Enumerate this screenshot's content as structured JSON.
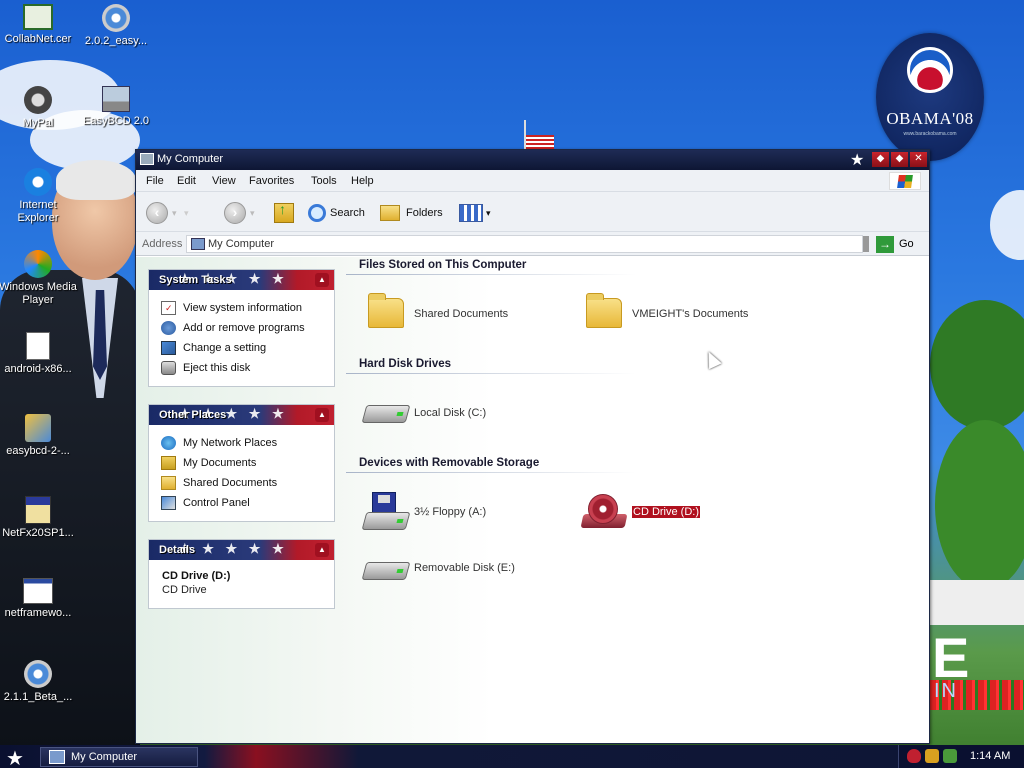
{
  "desktop": {
    "icons": [
      {
        "label": "CollabNet.cer",
        "icon": "certificate-icon"
      },
      {
        "label": "2.0.2_easy...",
        "icon": "installer-disc-icon"
      },
      {
        "label": "MyPal",
        "icon": "raccoon-shortcut-icon"
      },
      {
        "label": "EasyBCD 2.0",
        "icon": "computer-shortcut-icon"
      },
      {
        "label": "Internet Explorer",
        "icon": "internet-explorer-icon"
      },
      {
        "label": "Windows Media Player",
        "icon": "media-player-icon"
      },
      {
        "label": "android-x86...",
        "icon": "disc-image-icon"
      },
      {
        "label": "easybcd-2-...",
        "icon": "installer-icon"
      },
      {
        "label": "NetFx20SP1...",
        "icon": "setup-package-icon"
      },
      {
        "label": "netframewo...",
        "icon": "window-app-icon"
      },
      {
        "label": "2.1.1_Beta_...",
        "icon": "installer-disc-icon"
      }
    ],
    "wallpaper_logo": {
      "text": "OBAMA'08",
      "sub": "www.barackobama.com"
    },
    "wallpaper_text": {
      "big": "E",
      "small": "IN"
    }
  },
  "window": {
    "title": "My Computer",
    "menu": [
      "File",
      "Edit",
      "View",
      "Favorites",
      "Tools",
      "Help"
    ],
    "toolbar": {
      "back": "Back",
      "search": "Search",
      "folders": "Folders"
    },
    "address": {
      "label": "Address",
      "value": "My Computer",
      "go": "Go"
    },
    "panes": {
      "system_tasks": {
        "title": "System Tasks",
        "items": [
          "View system information",
          "Add or remove programs",
          "Change a setting",
          "Eject this disk"
        ]
      },
      "other_places": {
        "title": "Other Places",
        "items": [
          "My Network Places",
          "My Documents",
          "Shared Documents",
          "Control Panel"
        ]
      },
      "details": {
        "title": "Details",
        "name": "CD Drive (D:)",
        "type": "CD Drive"
      }
    },
    "sections": {
      "files": {
        "title": "Files Stored on This Computer",
        "items": [
          "Shared Documents",
          "VMEIGHT's Documents"
        ]
      },
      "hard_disks": {
        "title": "Hard Disk Drives",
        "items": [
          "Local Disk (C:)"
        ]
      },
      "removable": {
        "title": "Devices with Removable Storage",
        "items": [
          "3½ Floppy (A:)",
          "CD Drive (D:)",
          "Removable Disk (E:)"
        ]
      }
    }
  },
  "taskbar": {
    "task": "My Computer",
    "clock": "1:14 AM"
  },
  "colors": {
    "titlebar": "#0e1634",
    "selection": "#b0101e",
    "pane_header_red": "#c02030"
  }
}
